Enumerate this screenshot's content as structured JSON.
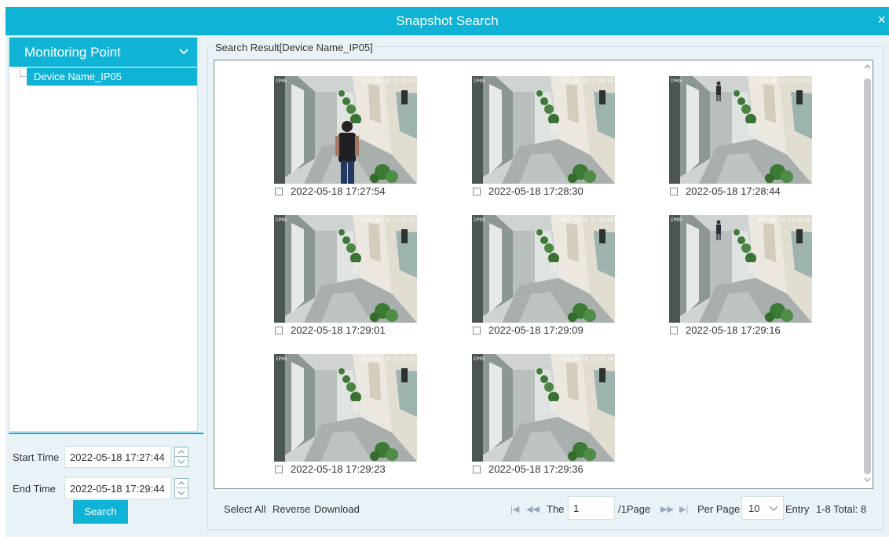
{
  "dialog": {
    "title": "Snapshot Search",
    "close_glyph": "×"
  },
  "left_panel": {
    "header_label": "Monitoring Point",
    "header_icon": "chevron-down-icon",
    "tree_items": [
      "Device Name_IP05"
    ],
    "start_time_label": "Start Time",
    "start_time_value": "2022-05-18 17:27:44",
    "end_time_label": "End Time",
    "end_time_value": "2022-05-18 17:29:44",
    "search_label": "Search"
  },
  "results": {
    "group_title": "Search Result[Device Name_IP05]",
    "snapshots": [
      {
        "timestamp": "2022-05-18 17:27:54",
        "osd_left": "IP05",
        "osd_right": "2022-05-18 17:27:53",
        "person": "foreground"
      },
      {
        "timestamp": "2022-05-18 17:28:30",
        "osd_left": "IP05",
        "osd_right": "2022-05-18 17:28:30",
        "person": "none"
      },
      {
        "timestamp": "2022-05-18 17:28:44",
        "osd_left": "IP05",
        "osd_right": "2022-05-18 17:28:43",
        "person": "far"
      },
      {
        "timestamp": "2022-05-18 17:29:01",
        "osd_left": "IP05",
        "osd_right": "2022-05-18 17:29:01",
        "person": "none"
      },
      {
        "timestamp": "2022-05-18 17:29:09",
        "osd_left": "IP05",
        "osd_right": "2022-05-18 17:29:09",
        "person": "none"
      },
      {
        "timestamp": "2022-05-18 17:29:16",
        "osd_left": "IP05",
        "osd_right": "2022-05-18 17:29:16",
        "person": "far"
      },
      {
        "timestamp": "2022-05-18 17:29:23",
        "osd_left": "IP05",
        "osd_right": "2022-05-18 17:29:23",
        "person": "none"
      },
      {
        "timestamp": "2022-05-18 17:29:36",
        "osd_left": "IP05",
        "osd_right": "2022-05-18 17:29:36",
        "person": "none"
      }
    ]
  },
  "toolbar": {
    "select_all": "Select All",
    "reverse": "Reverse",
    "download": "Download",
    "the_label": "The",
    "page_value": "1",
    "page_suffix": "/1Page",
    "per_page_label": "Per Page",
    "per_page_value": "10",
    "entry_label": "Entry",
    "range_total": "1-8 Total: 8"
  },
  "colors": {
    "accent": "#0fb3d6",
    "background": "#e9f2f6"
  }
}
